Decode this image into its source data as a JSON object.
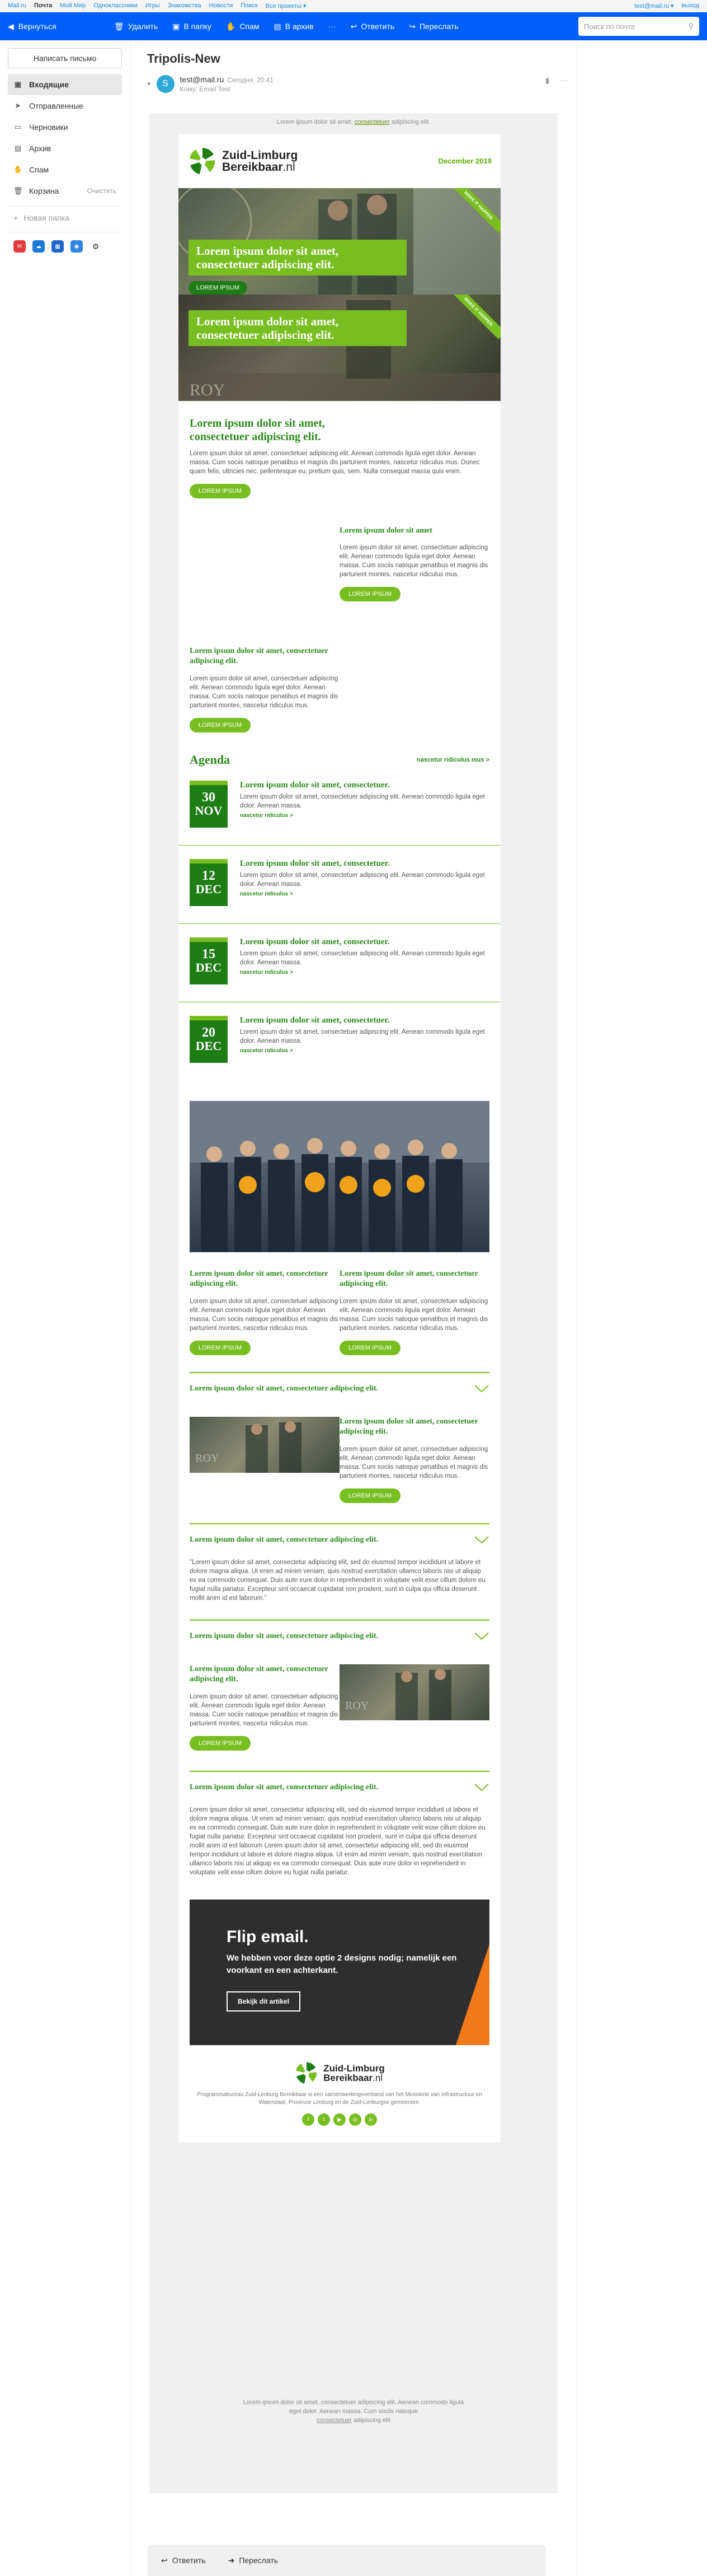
{
  "portal": {
    "links": [
      "Mail.ru",
      "Почта",
      "Мой Мир",
      "Одноклассники",
      "Игры",
      "Знакомства",
      "Новости",
      "Поиск",
      "Все проекты ▾"
    ],
    "user": "test@mail.ru ▾",
    "logout": "выход"
  },
  "toolbar": {
    "back": "Вернуться",
    "delete": "Удалить",
    "folder": "В папку",
    "spam": "Спам",
    "archive": "В архив",
    "more": "···",
    "reply": "Ответить",
    "forward": "Переслать",
    "search_placeholder": "Поиск по почте"
  },
  "sidebar": {
    "compose": "Написать письмо",
    "folders": [
      {
        "label": "Входящие",
        "icon": "inbox-icon"
      },
      {
        "label": "Отправленные",
        "icon": "sent-icon"
      },
      {
        "label": "Черновики",
        "icon": "drafts-icon"
      },
      {
        "label": "Архив",
        "icon": "archive-icon"
      },
      {
        "label": "Спам",
        "icon": "spam-icon"
      },
      {
        "label": "Корзина",
        "icon": "trash-icon",
        "extra": "Очистить"
      }
    ],
    "new_folder": "Новая папка"
  },
  "message": {
    "subject": "Tripolis-New",
    "avatar_letter": "S",
    "from": "test@mail.ru",
    "date": "Сегодня, 20:41",
    "to": "Кому: Email Test"
  },
  "email": {
    "preheader_a": "Lorem ipsum dolor sit amet,",
    "preheader_link": "consectetuer",
    "preheader_b": "adipiscing elit.",
    "logo_line1": "Zuid-Limburg",
    "logo_line2a": "Bereikbaar",
    "logo_line2b": ".nl",
    "date": "December 2019",
    "hero1_title": "Lorem ipsum dolor sit amet, consectetuer adipiscing elit.",
    "hero1_btn": "LOREM IPSUM",
    "hero_ribbon": "MAKE IT HAPPEN",
    "hero2_title": "Lorem ipsum dolor sit amet, consectetuer adipiscing elit.",
    "intro_title": "Lorem ipsum dolor sit amet, consectetuer adipiscing elit.",
    "intro_body": "Lorem ipsum dolor sit amet, consectetuer adipiscing elit. Aenean commodo ligula eget dolor. Aenean massa. Cum sociis natoque penatibus et magnis dis parturient montes, nascetur ridiculus mus. Donec quam felis, ultricies nec, pellentesque eu, pretium quis, sem. Nulla consequat massa quis enim.",
    "intro_btn": "LOREM IPSUM",
    "block1_title": "Lorem ipsum dolor sit amet",
    "block1_body": "Lorem ipsum dolor sit amet, consectetuer adipiscing elit. Aenean commodo ligula eget dolor. Aenean massa. Cum sociis natoque penatibus et magnis dis parturient montes, nascetur ridiculus mus.",
    "block1_btn": "LOREM IPSUM",
    "block2_title": "Lorem ipsum dolor sit amet, consectetuer adipiscing elit.",
    "block2_body": "Lorem ipsum dolor sit amet, consectetuer adipiscing elit. Aenean commodo ligula eget dolor. Aenean massa. Cum sociis natoque penatibus et magnis dis parturient montes, nascetur ridiculus mus.",
    "block2_btn": "LOREM IPSUM",
    "agenda_title": "Agenda",
    "agenda_link": "nascetur ridiculus mus >",
    "agenda": [
      {
        "day": "30",
        "month": "NOV",
        "title": "Lorem ipsum dolor sit amet, consectetuer.",
        "body": "Lorem ipsum dolor sit amet, consectetuer adipiscing elit. Aenean commodo ligula eget dolor. Aenean massa.",
        "link": "nascetur ridiculus >"
      },
      {
        "day": "12",
        "month": "DEC",
        "title": "Lorem ipsum dolor sit amet, consectetuer.",
        "body": "Lorem ipsum dolor sit amet, consectetuer adipiscing elit. Aenean commodo ligula eget dolor. Aenean massa.",
        "link": "nascetur ridiculus >"
      },
      {
        "day": "15",
        "month": "DEC",
        "title": "Lorem ipsum dolor sit amet, consectetuer.",
        "body": "Lorem ipsum dolor sit amet, consectetuer adipiscing elit. Aenean commodo ligula eget dolor. Aenean massa.",
        "link": "nascetur ridiculus >"
      },
      {
        "day": "20",
        "month": "DEC",
        "title": "Lorem ipsum dolor sit amet, consectetuer.",
        "body": "Lorem ipsum dolor sit amet, consectetuer adipiscing elit. Aenean commodo ligula eget dolor. Aenean massa.",
        "link": "nascetur ridiculus >"
      }
    ],
    "cols": [
      {
        "title": "Lorem ipsum dolor sit amet, consectetuer adipiscing elit.",
        "body": "Lorem ipsum dolor sit amet, consectetuer adipiscing elit. Aenean commodo ligula eget dolor. Aenean massa. Cum sociis natoque penatibus et magnis dis parturient montes, nascetur ridiculus mus.",
        "btn": "LOREM IPSUM"
      },
      {
        "title": "Lorem ipsum dolor sit amet, consectetuer adipiscing elit.",
        "body": "Lorem ipsum dolor sit amet, consectetuer adipiscing elit. Aenean commodo ligula eget dolor. Aenean massa. Cum sociis natoque penatibus et magnis dis parturient montes, nascetur ridiculus mus.",
        "btn": "LOREM IPSUM"
      }
    ],
    "acc1_title": "Lorem ipsum dolor sit amet, consectetuer adipiscing elit.",
    "acc1_block_title": "Lorem ipsum dolor sit amet, consectetuer adipiscing elit.",
    "acc1_block_body": "Lorem ipsum dolor sit amet, consectetuer adipiscing elit. Aenean commodo ligula eget dolor. Aenean massa. Cum sociis natoque penatibus et magnis dis parturient montes, nascetur ridiculus mus.",
    "acc1_btn": "LOREM IPSUM",
    "acc2_title": "Lorem ipsum dolor sit amet, consectetuer adipiscing elit.",
    "acc2_body": "\"Lorem ipsum dolor sit amet, consectetur adipiscing elit, sed do eiusmod tempor incididunt ut labore et dolore magna aliqua. Ut enim ad minim veniam, quis nostrud exercitation ullamco laboris nisi ut aliquip ex ea commodo consequat. Duis aute irure dolor in reprehenderit in voluptate velit esse cillum dolore eu fugiat nulla pariatur. Excepteur sint occaecat cupidatat non proident, sunt in culpa qui officia deserunt mollit anim id est laborum.\"",
    "acc3_title": "Lorem ipsum dolor sit amet, consectetuer adipiscing elit.",
    "acc3_block_title": "Lorem ipsum dolor sit amet, consectetuer adipiscing elit.",
    "acc3_block_body": "Lorem ipsum dolor sit amet, consectetuer adipiscing elit. Aenean commodo ligula eget dolor. Aenean massa. Cum sociis natoque penatibus et magnis dis parturient montes, nascetur ridiculus mus.",
    "acc3_btn": "LOREM IPSUM",
    "acc4_title": "Lorem ipsum dolor sit amet, consectetuer adipiscing elit.",
    "acc4_body": "Lorem ipsum dolor sit amet, consectetur adipiscing elit, sed do eiusmod tempor incididunt ut labore et dolore magna aliqua. Ut enim ad minim veniam, quis nostrud exercitation ullamco laboris nisi ut aliquip ex ea commodo consequat. Duis aute irure dolor in reprehenderit in voluptate velit esse cillum dolore eu fugiat nulla pariatur. Excepteur sint occaecat cupidatat non proident, sunt in culpa qui officia deserunt mollit anim id est laborum Lorem ipsum dolor sit amet, consectetur adipiscing elit, sed do eiusmod tempor incididunt ut labore et dolore magna aliqua. Ut enim ad minim veniam, quis nostrud exercitation ullamco laboris nisi ut aliquip ex ea commodo consequat. Duis aute irure dolor in reprehenderit in voluptate velit esse cillum dolore eu fugiat nulla pariatur.",
    "flip_title": "Flip email.",
    "flip_sub": "We hebben voor deze optie 2 designs nodig; namelijk een voorkant en een achterkant.",
    "flip_btn": "Bekijk dit artikel",
    "footer_text": "Programmabureau Zuid-Limburg Bereikbaar is een samenwerkingsverband van het Ministerie van Infrastructuur en Waterstaat, Provincie Limburg en de Zuid-Limburgse gemeenten.",
    "post_footer_a": "Lorem ipsum dolor sit amet, consectetuer adipiscing elit. Aenean commodo ligula eget dolor. Aenean massa. Cum sociis natoque",
    "post_footer_link": "consectetuer",
    "post_footer_b": "adipiscing elit"
  },
  "replybar": {
    "reply": "Ответить",
    "forward": "Переслать"
  },
  "colors": {
    "toolbar": "#005ff9",
    "green": "#78be20",
    "dark_green": "#1e7d15"
  }
}
